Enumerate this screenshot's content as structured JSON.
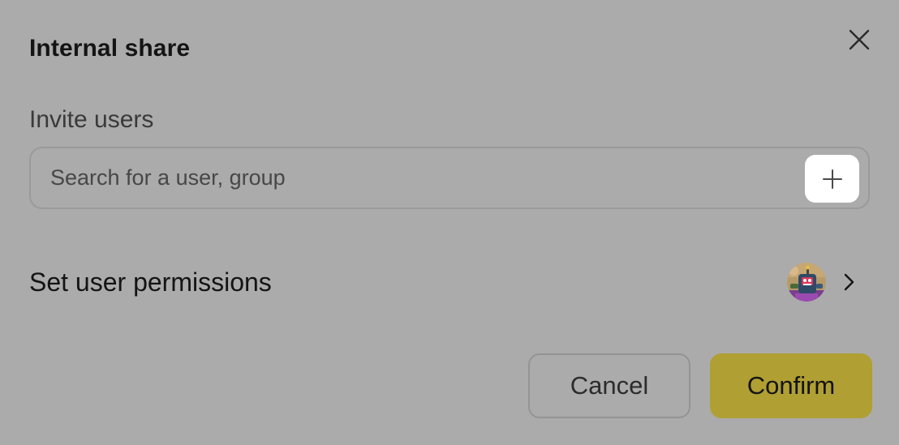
{
  "dialog": {
    "title": "Internal share",
    "close_icon": "close-icon"
  },
  "invite": {
    "label": "Invite users",
    "placeholder": "Search for a user, group",
    "value": "",
    "add_icon": "plus-icon"
  },
  "permissions": {
    "label": "Set user permissions",
    "avatar_icon": "user-avatar",
    "chevron_icon": "chevron-right-icon"
  },
  "actions": {
    "cancel_label": "Cancel",
    "confirm_label": "Confirm"
  },
  "colors": {
    "background": "#ababab",
    "accent": "#b09f33",
    "add_button_bg": "#ffffff"
  }
}
